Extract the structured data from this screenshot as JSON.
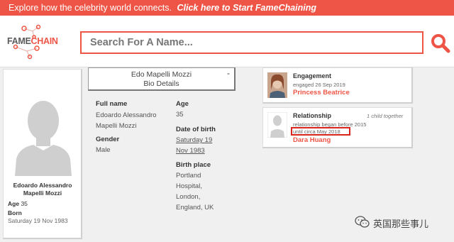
{
  "banner": {
    "text": "Explore how the celebrity world connects.",
    "cta": "Click here to Start FameChaining"
  },
  "header": {
    "logo_part1": "FAME",
    "logo_part2": "CHAIN",
    "search_text": "Search For A Name...",
    "search_icon": "magnifier-icon"
  },
  "profile": {
    "name_line1": "Edoardo Alessandro",
    "name_line2": "Mapelli Mozzi",
    "age_label": "Age",
    "age_value": "35",
    "born_label": "Born",
    "born_value": "Saturday 19 Nov 1983",
    "avatar_icon": "silhouette-icon"
  },
  "bio": {
    "title_line1": "Edo Mapelli Mozzi",
    "title_line2": "Bio Details",
    "collapse": "-",
    "fullname_label": "Full name",
    "fullname_line1": "Edoardo Alessandro",
    "fullname_line2": "Mapelli Mozzi",
    "gender_label": "Gender",
    "gender_value": "Male",
    "age_label": "Age",
    "age_value": "35",
    "dob_label": "Date of birth",
    "dob_line1": "Saturday 19",
    "dob_line2": "Nov 1983",
    "birthplace_label": "Birth place",
    "birthplace_lines": [
      "Portland",
      "Hospital,",
      "London,",
      "England, UK"
    ]
  },
  "relations": [
    {
      "type": "Engagement",
      "detail": "engaged 26 Sep 2019",
      "name": "Princess Beatrice"
    },
    {
      "type": "Relationship",
      "child_note": "1 child together",
      "detail": "relationship began before 2015",
      "detail2": "until circa May 2018",
      "name": "Dara Huang"
    }
  ],
  "watermark": {
    "text": "英国那些事儿",
    "icon": "wechat-icon"
  },
  "colors": {
    "accent": "#ef5546",
    "highlight_box": "#d9241f"
  }
}
